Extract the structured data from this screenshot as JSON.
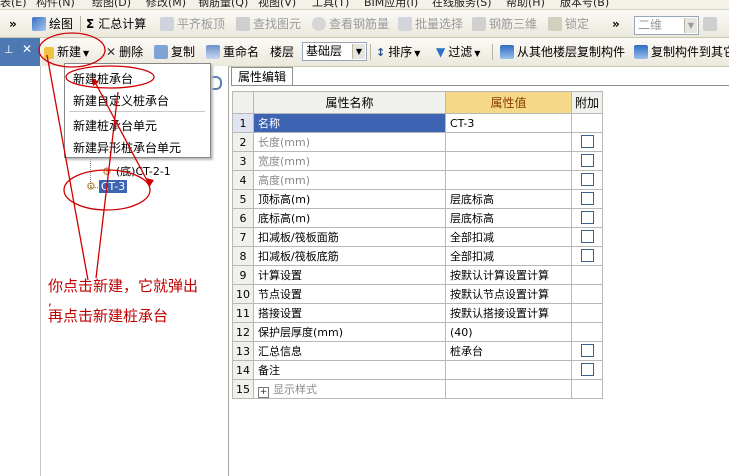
{
  "menubar": {
    "items": [
      "表(E)",
      "构件(N)",
      "绘图(D)",
      "修改(M)",
      "钢筋量(Q)",
      "视图(V)",
      "工具(T)",
      "BIM应用(I)",
      "在线服务(S)",
      "帮助(H)",
      "版本号(B)"
    ]
  },
  "toolbar1": {
    "draw": "绘图",
    "sum": "汇总计算",
    "flat_top": "平齐板顶",
    "find": "查找图元",
    "view_rebar": "查看钢筋量",
    "batch_select": "批量选择",
    "rebar_3d": "钢筋三维",
    "lock": "锁定",
    "view_select": "二维"
  },
  "toolbar2": {
    "new": "新建",
    "delete": "删除",
    "copy": "复制",
    "rename": "重命名",
    "floor_label": "楼层",
    "floor_value": "基础层",
    "sort": "排序",
    "filter": "过滤",
    "copy_from_floor": "从其他楼层复制构件",
    "copy_to": "复制构件到其它"
  },
  "new_menu": {
    "items": [
      "新建桩承台",
      "新建自定义桩承台",
      "新建桩承台单元",
      "新建异形桩承台单元"
    ]
  },
  "tree": {
    "item1": "(底)CT-2-1",
    "item2": "CT-3"
  },
  "tab": {
    "label": "属性编辑"
  },
  "table": {
    "headers": [
      "属性名称",
      "属性值",
      "附加"
    ],
    "rows": [
      {
        "num": "1",
        "name": "名称",
        "value": "CT-3",
        "check": false
      },
      {
        "num": "2",
        "name": "长度(mm)",
        "value": "",
        "check": true
      },
      {
        "num": "3",
        "name": "宽度(mm)",
        "value": "",
        "check": true
      },
      {
        "num": "4",
        "name": "高度(mm)",
        "value": "",
        "check": true
      },
      {
        "num": "5",
        "name": "顶标高(m)",
        "value": "层底标高",
        "check": true
      },
      {
        "num": "6",
        "name": "底标高(m)",
        "value": "层底标高",
        "check": true
      },
      {
        "num": "7",
        "name": "扣减板/筏板面筋",
        "value": "全部扣减",
        "check": true
      },
      {
        "num": "8",
        "name": "扣减板/筏板底筋",
        "value": "全部扣减",
        "check": true
      },
      {
        "num": "9",
        "name": "计算设置",
        "value": "按默认计算设置计算",
        "check": false
      },
      {
        "num": "10",
        "name": "节点设置",
        "value": "按默认节点设置计算",
        "check": false
      },
      {
        "num": "11",
        "name": "搭接设置",
        "value": "按默认搭接设置计算",
        "check": false
      },
      {
        "num": "12",
        "name": "保护层厚度(mm)",
        "value": "(40)",
        "check": false
      },
      {
        "num": "13",
        "name": "汇总信息",
        "value": "桩承台",
        "check": true
      },
      {
        "num": "14",
        "name": "备注",
        "value": "",
        "check": true
      },
      {
        "num": "15",
        "name": "显示样式",
        "value": "",
        "check": false
      }
    ]
  },
  "annotation": {
    "line1": "你点击新建，它就弹出",
    "line2": ",",
    "line3": "再点击新建桩承台"
  },
  "colors": {
    "selection": "#3c64b2",
    "value_header": "#f5d989",
    "annotation": "#c00000",
    "panel_header": "#4c78b4"
  }
}
